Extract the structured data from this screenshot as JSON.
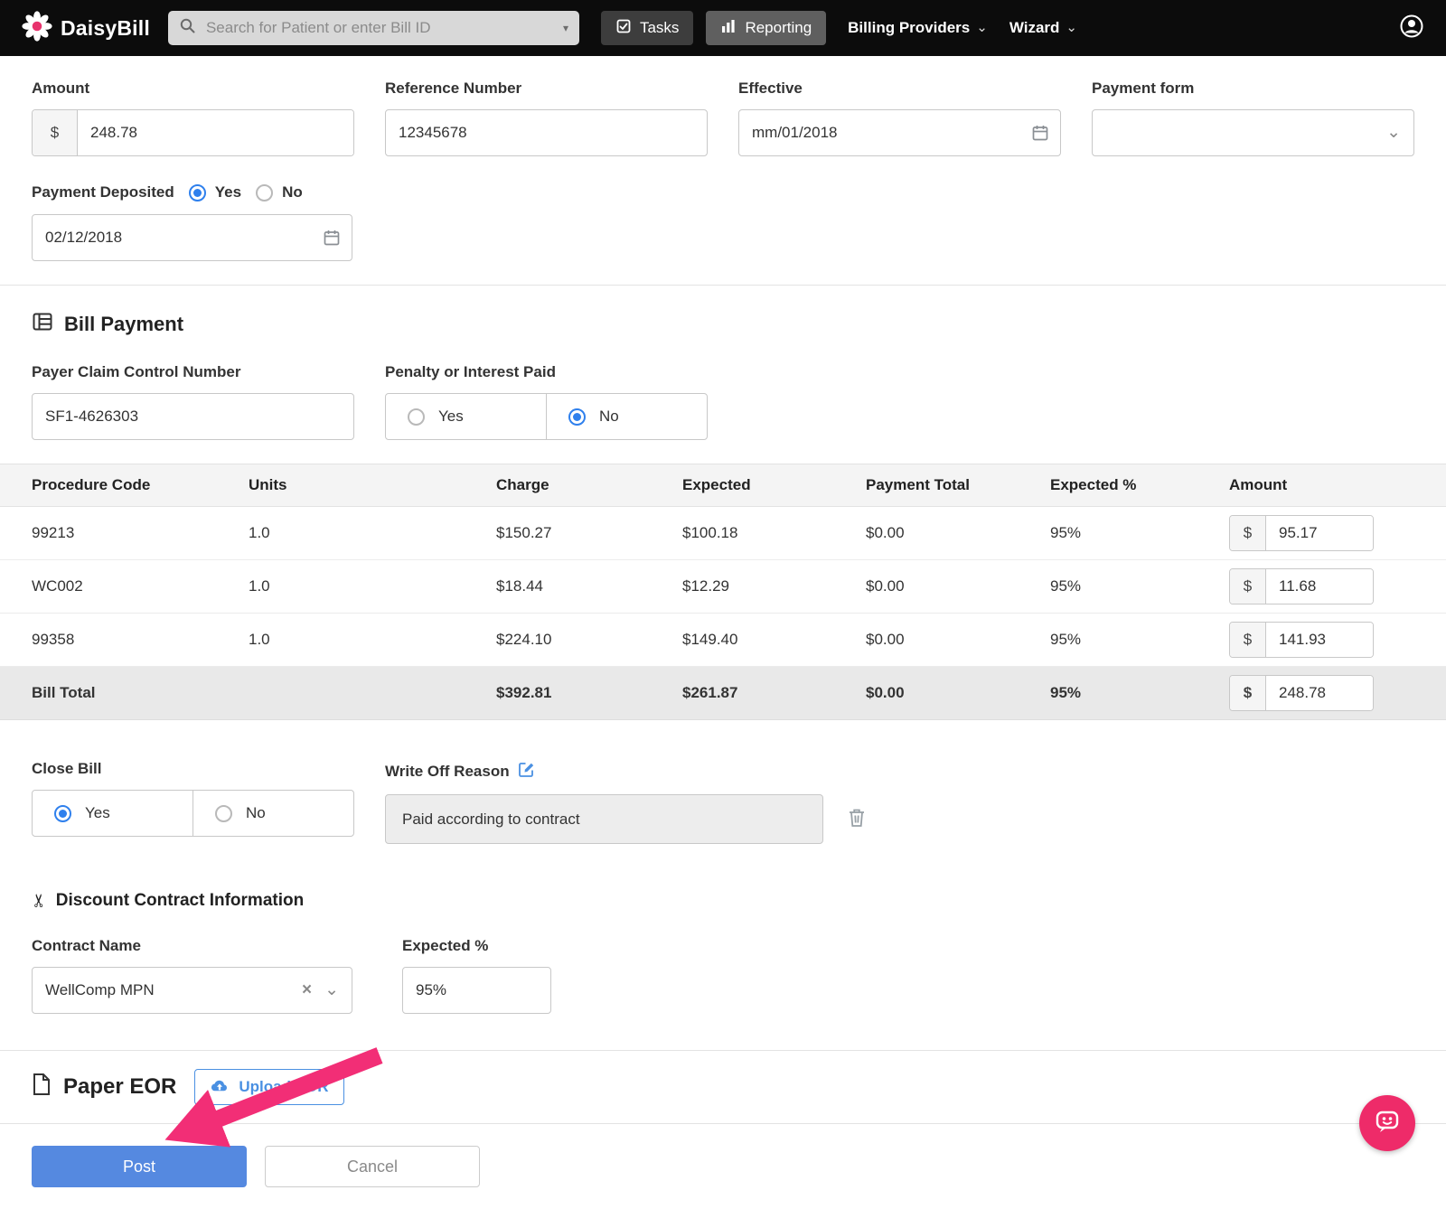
{
  "icons": {
    "caret_down": "▾",
    "chevron_down": "⌄",
    "close": "×",
    "scissors": "✂"
  },
  "navbar": {
    "brand": "DaisyBill",
    "search_placeholder": "Search for Patient or enter Bill ID",
    "tasks": "Tasks",
    "reporting": "Reporting",
    "billing_providers": "Billing Providers",
    "wizard": "Wizard"
  },
  "deposit_form": {
    "amount_label": "Amount",
    "currency": "$",
    "amount_value": "248.78",
    "reference_label": "Reference Number",
    "reference_value": "12345678",
    "effective_label": "Effective",
    "effective_value": "mm/01/2018",
    "payment_form_label": "Payment form",
    "payment_form_value": "",
    "deposited_label": "Payment Deposited",
    "yes": "Yes",
    "no": "No",
    "deposited_date": "02/12/2018"
  },
  "bill_payment": {
    "title": "Bill Payment",
    "payer_claim_label": "Payer Claim Control Number",
    "payer_claim_value": "SF1-4626303",
    "penalty_label": "Penalty or Interest Paid",
    "yes": "Yes",
    "no": "No"
  },
  "line_items": {
    "currency": "$",
    "headers": {
      "procedure_code": "Procedure Code",
      "units": "Units",
      "charge": "Charge",
      "expected": "Expected",
      "payment_total": "Payment Total",
      "expected_pct": "Expected %",
      "amount": "Amount"
    },
    "rows": [
      {
        "procedure_code": "99213",
        "units": "1.0",
        "charge": "$150.27",
        "expected": "$100.18",
        "payment_total": "$0.00",
        "expected_pct": "95%",
        "amount": "95.17"
      },
      {
        "procedure_code": "WC002",
        "units": "1.0",
        "charge": "$18.44",
        "expected": "$12.29",
        "payment_total": "$0.00",
        "expected_pct": "95%",
        "amount": "11.68"
      },
      {
        "procedure_code": "99358",
        "units": "1.0",
        "charge": "$224.10",
        "expected": "$149.40",
        "payment_total": "$0.00",
        "expected_pct": "95%",
        "amount": "141.93"
      }
    ],
    "total": {
      "label": "Bill Total",
      "charge": "$392.81",
      "expected": "$261.87",
      "payment_total": "$0.00",
      "expected_pct": "95%",
      "amount": "248.78"
    }
  },
  "close_bill": {
    "label": "Close Bill",
    "yes": "Yes",
    "no": "No",
    "write_off_label": "Write Off Reason",
    "write_off_value": "Paid according to contract"
  },
  "discount_contract": {
    "title": "Discount Contract Information",
    "contract_name_label": "Contract Name",
    "contract_name_value": "WellComp MPN",
    "expected_pct_label": "Expected %",
    "expected_pct_value": "95%"
  },
  "paper_eor": {
    "title": "Paper EOR",
    "upload_button": "Upload EOR"
  },
  "footer": {
    "post": "Post",
    "cancel": "Cancel"
  }
}
